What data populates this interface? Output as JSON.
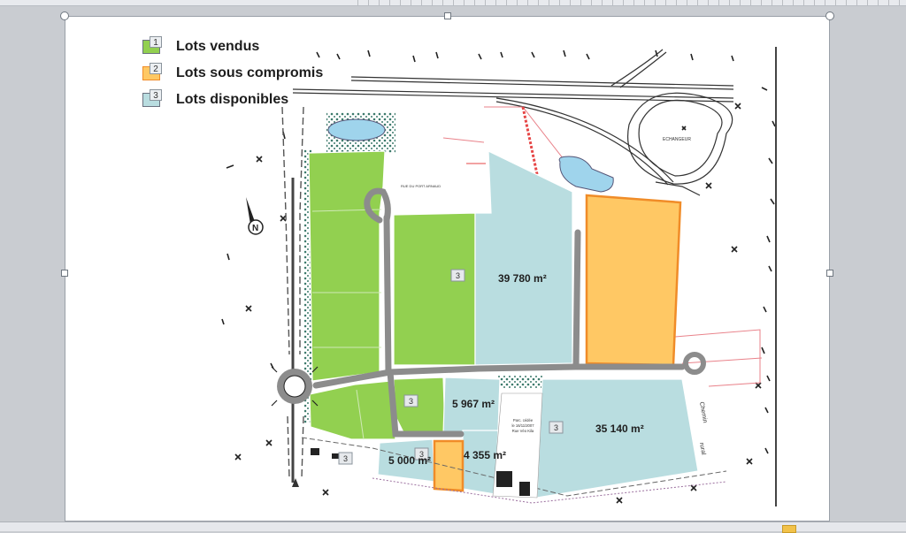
{
  "legend": [
    {
      "num": "1",
      "label": "Lots vendus",
      "color": "#92d050"
    },
    {
      "num": "2",
      "label": "Lots sous compromis",
      "color": "#ffc864"
    },
    {
      "num": "3",
      "label": "Lots disponibles",
      "color": "#b9dde0"
    }
  ],
  "map": {
    "north_symbol": "N",
    "interchange_label": "ECHANGEUR",
    "road_label": [
      "Chemin",
      "rural"
    ],
    "road_name": "RUE DU PORT ARNAUD",
    "existing_parcel_label": [
      "Parc. cédée",
      "le 16/11/2007",
      "Rue Véo Kila"
    ],
    "lot_tag": "3",
    "areas": {
      "lot_39780": "39 780 m²",
      "lot_5967": "5  967 m²",
      "lot_35140": "35 140 m²",
      "lot_5000": "5 000 m²",
      "lot_4355": "4 355 m²"
    }
  },
  "colors": {
    "sold": "#92d050",
    "compromise": "#ffc864",
    "compromise_border": "#f08c28",
    "available": "#b9dde0",
    "road": "#8c8c8c",
    "water": "#9fd4ec",
    "trees": "#3c7a6c"
  }
}
